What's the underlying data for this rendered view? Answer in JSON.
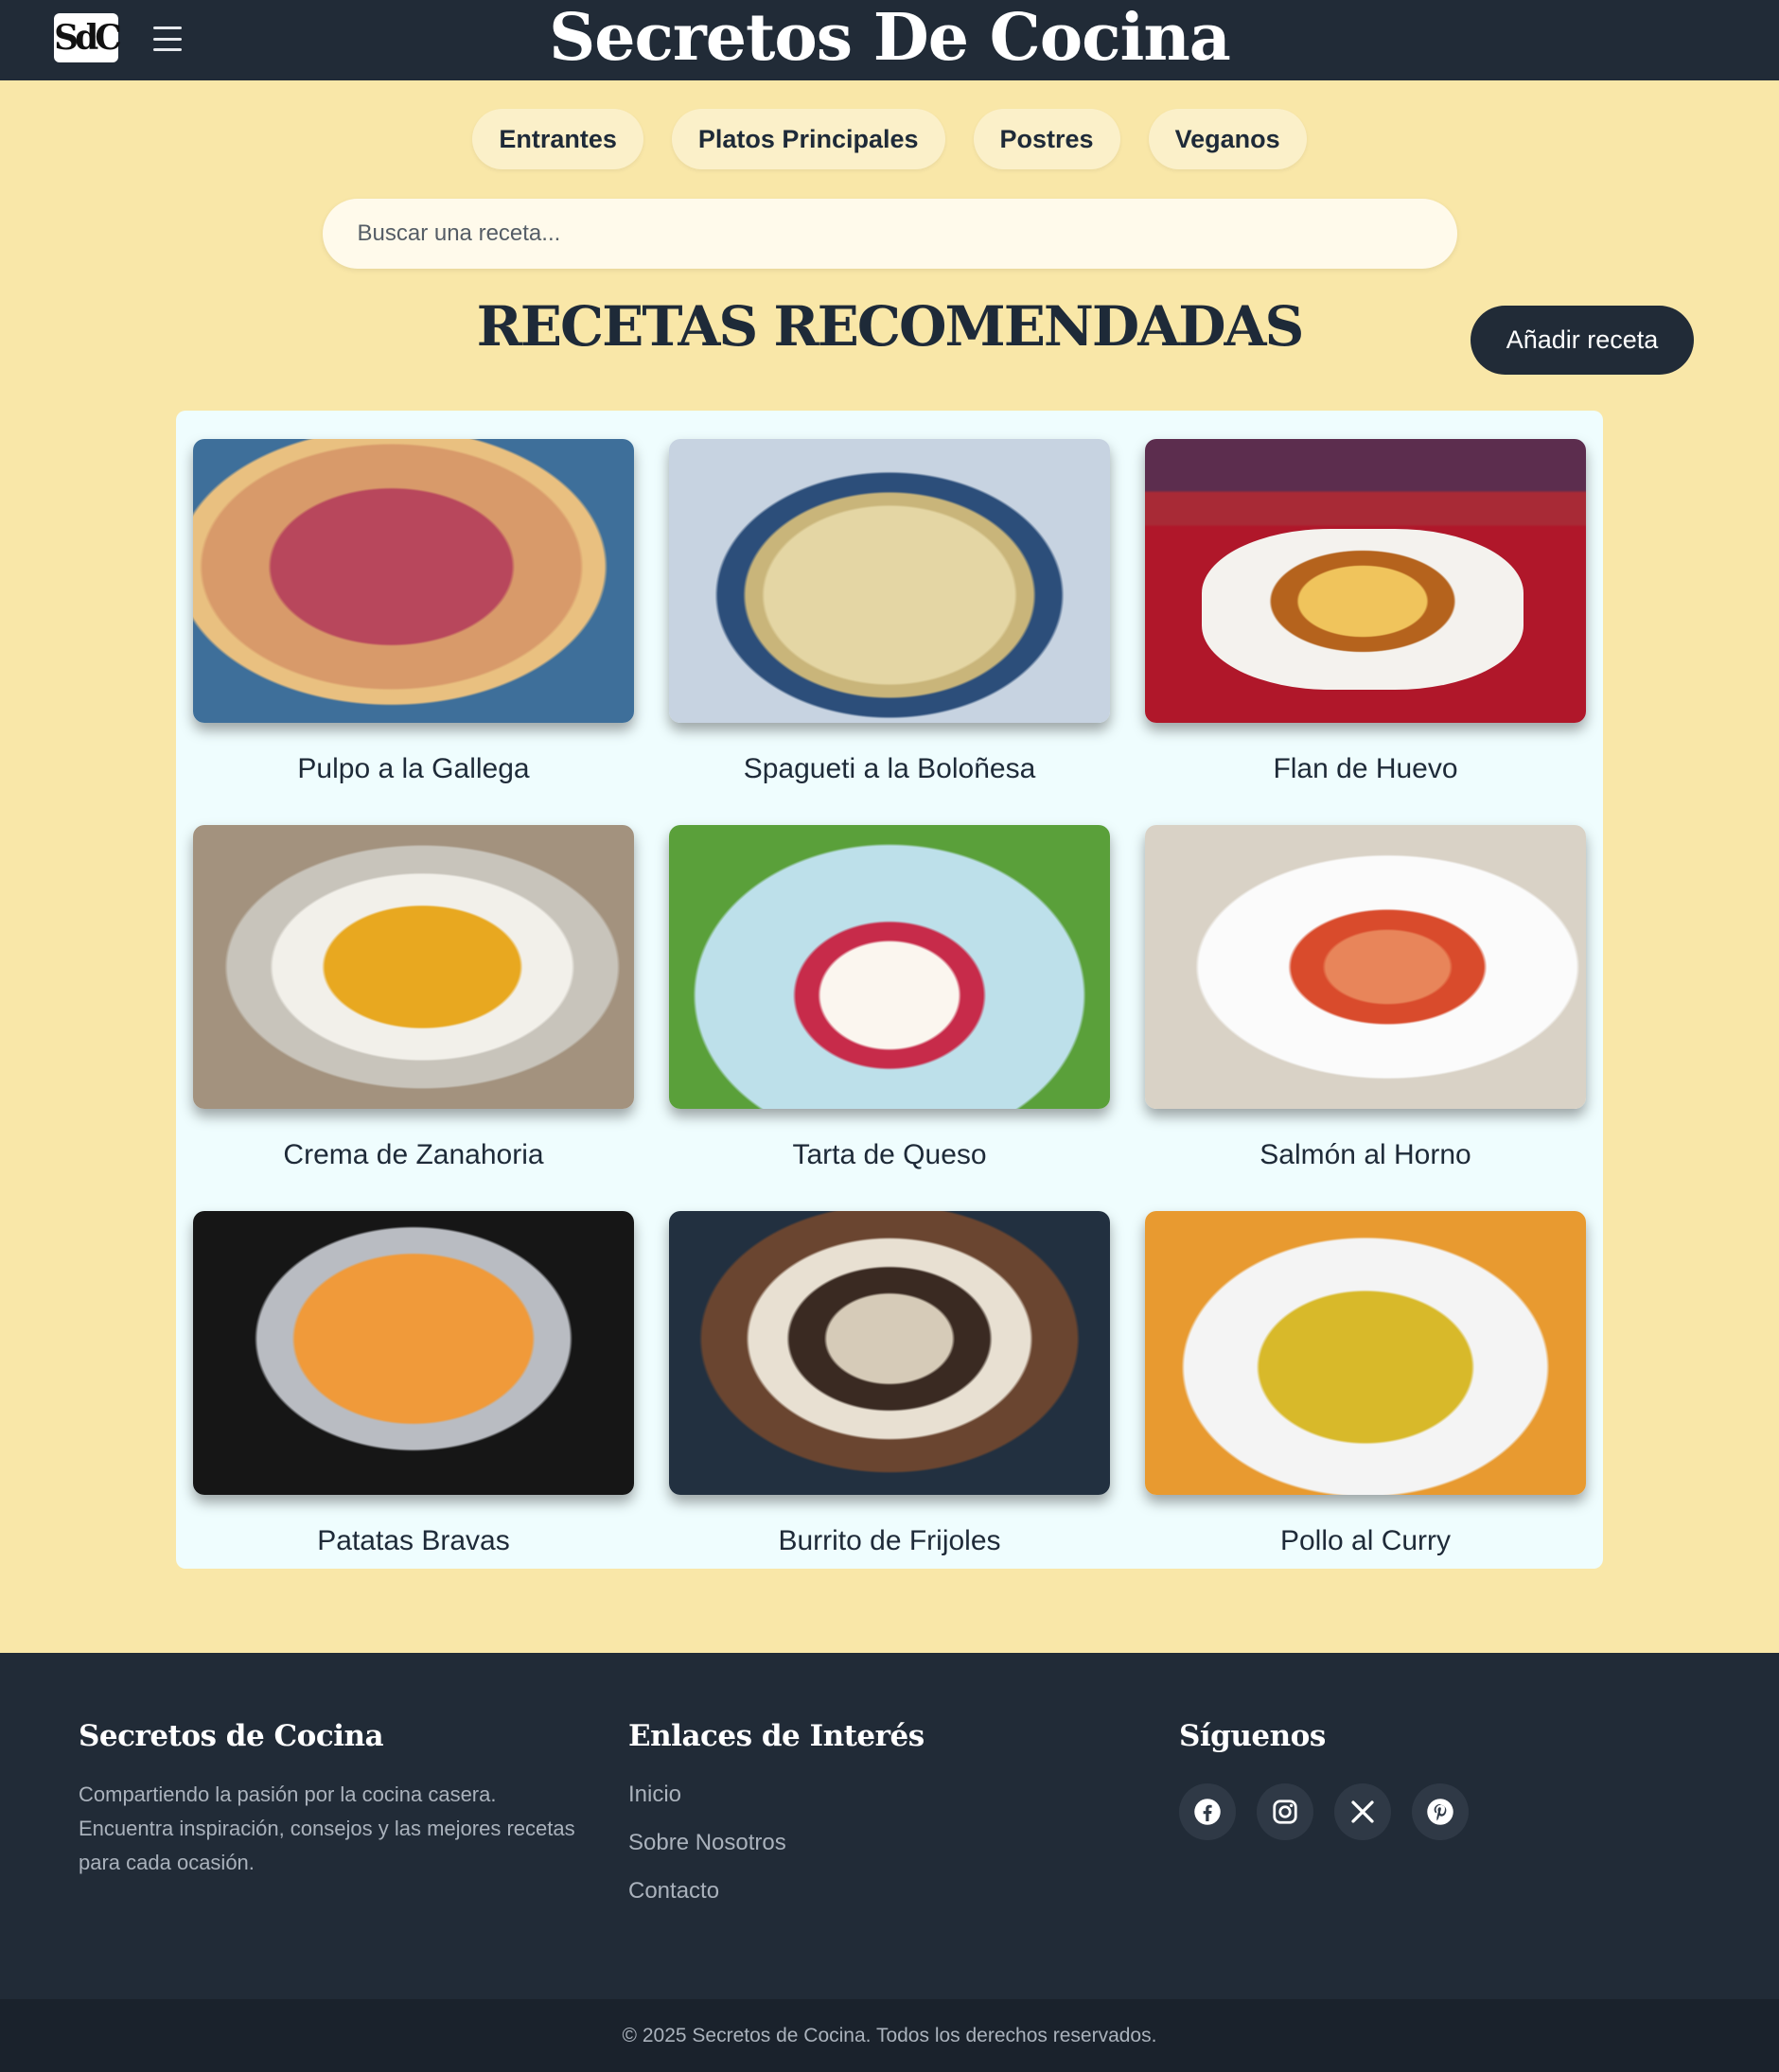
{
  "header": {
    "logo_text": "SdC",
    "title": "Secretos De Cocina"
  },
  "categories": [
    "Entrantes",
    "Platos Principales",
    "Postres",
    "Veganos"
  ],
  "search": {
    "placeholder": "Buscar una receta..."
  },
  "section": {
    "title": "RECETAS RECOMENDADAS",
    "add_button": "Añadir receta"
  },
  "recipes": [
    {
      "name": "Pulpo a la Gallega"
    },
    {
      "name": "Spagueti a la Boloñesa"
    },
    {
      "name": "Flan de Huevo"
    },
    {
      "name": "Crema de Zanahoria"
    },
    {
      "name": "Tarta de Queso"
    },
    {
      "name": "Salmón al Horno"
    },
    {
      "name": "Patatas Bravas"
    },
    {
      "name": "Burrito de Frijoles"
    },
    {
      "name": "Pollo al Curry"
    }
  ],
  "footer": {
    "about_title": "Secretos de Cocina",
    "about_text": "Compartiendo la pasión por la cocina casera. Encuentra inspiración, consejos y las mejores recetas para cada ocasión.",
    "links_title": "Enlaces de Interés",
    "links": [
      "Inicio",
      "Sobre Nosotros",
      "Contacto"
    ],
    "social_title": "Síguenos",
    "social_icons": [
      "facebook-icon",
      "instagram-icon",
      "x-icon",
      "pinterest-icon"
    ],
    "copyright": "© 2025 Secretos de Cocina. Todos los derechos reservados."
  },
  "colors": {
    "page_bg": "#f9e7a8",
    "navbar_bg": "#212b37",
    "panel_bg": "#effdfe",
    "pill_bg": "#fbf0c9",
    "text_dark": "#1e2a38"
  }
}
